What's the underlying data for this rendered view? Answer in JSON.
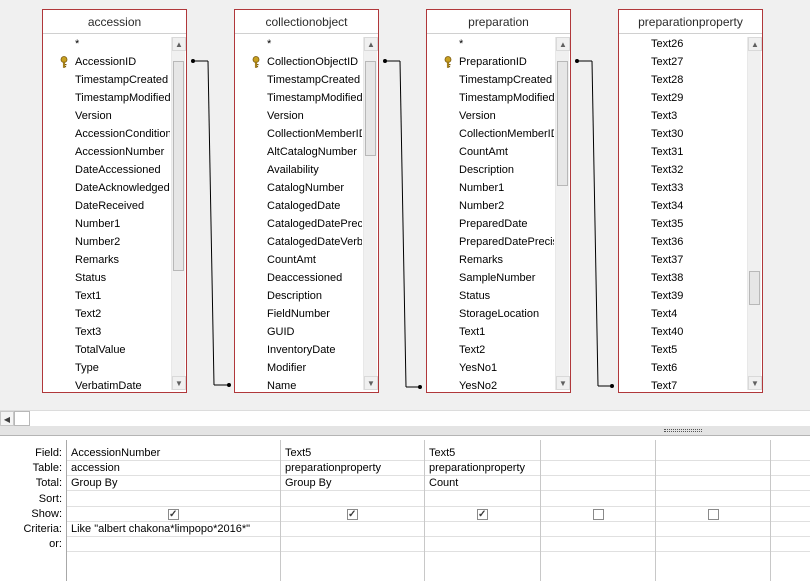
{
  "tables": [
    {
      "title": "accession",
      "fields": [
        "*",
        "AccessionID",
        "TimestampCreated",
        "TimestampModified",
        "Version",
        "AccessionCondition",
        "AccessionNumber",
        "DateAccessioned",
        "DateAcknowledged",
        "DateReceived",
        "Number1",
        "Number2",
        "Remarks",
        "Status",
        "Text1",
        "Text2",
        "Text3",
        "TotalValue",
        "Type",
        "VerbatimDate"
      ],
      "key_field": "AccessionID"
    },
    {
      "title": "collectionobject",
      "fields": [
        "*",
        "CollectionObjectID",
        "TimestampCreated",
        "TimestampModified",
        "Version",
        "CollectionMemberID",
        "AltCatalogNumber",
        "Availability",
        "CatalogNumber",
        "CatalogedDate",
        "CatalogedDatePrecision",
        "CatalogedDateVerbatim",
        "CountAmt",
        "Deaccessioned",
        "Description",
        "FieldNumber",
        "GUID",
        "InventoryDate",
        "Modifier",
        "Name"
      ],
      "key_field": "CollectionObjectID"
    },
    {
      "title": "preparation",
      "fields": [
        "*",
        "PreparationID",
        "TimestampCreated",
        "TimestampModified",
        "Version",
        "CollectionMemberID",
        "CountAmt",
        "Description",
        "Number1",
        "Number2",
        "PreparedDate",
        "PreparedDatePrecision",
        "Remarks",
        "SampleNumber",
        "Status",
        "StorageLocation",
        "Text1",
        "Text2",
        "YesNo1",
        "YesNo2"
      ],
      "key_field": "PreparationID"
    },
    {
      "title": "preparationproperty",
      "fields": [
        "Text26",
        "Text27",
        "Text28",
        "Text29",
        "Text3",
        "Text30",
        "Text31",
        "Text32",
        "Text33",
        "Text34",
        "Text35",
        "Text36",
        "Text37",
        "Text38",
        "Text39",
        "Text4",
        "Text40",
        "Text5",
        "Text6",
        "Text7"
      ],
      "key_field": ""
    }
  ],
  "scroll": {
    "up": "▲",
    "down": "▼",
    "left": "◀"
  },
  "grid": {
    "row_labels": [
      "Field:",
      "Table:",
      "Total:",
      "Sort:",
      "Show:",
      "Criteria:",
      "or:"
    ],
    "columns": [
      {
        "field": "AccessionNumber",
        "table": "accession",
        "total": "Group By",
        "sort": "",
        "show": true,
        "criteria": "Like \"albert chakona*limpopo*2016*\"",
        "or": ""
      },
      {
        "field": "Text5",
        "table": "preparationproperty",
        "total": "Group By",
        "sort": "",
        "show": true,
        "criteria": "",
        "or": ""
      },
      {
        "field": "Text5",
        "table": "preparationproperty",
        "total": "Count",
        "sort": "",
        "show": true,
        "criteria": "",
        "or": ""
      },
      {
        "field": "",
        "table": "",
        "total": "",
        "sort": "",
        "show": false,
        "criteria": "",
        "or": ""
      },
      {
        "field": "",
        "table": "",
        "total": "",
        "sort": "",
        "show": false,
        "criteria": "",
        "or": ""
      },
      {
        "field": "",
        "table": "",
        "total": "",
        "sort": "",
        "show": null,
        "criteria": "",
        "or": ""
      }
    ]
  },
  "colors": {
    "table_border": "#b0373a",
    "join_line": "#000000",
    "key_icon": "#c8a020"
  }
}
